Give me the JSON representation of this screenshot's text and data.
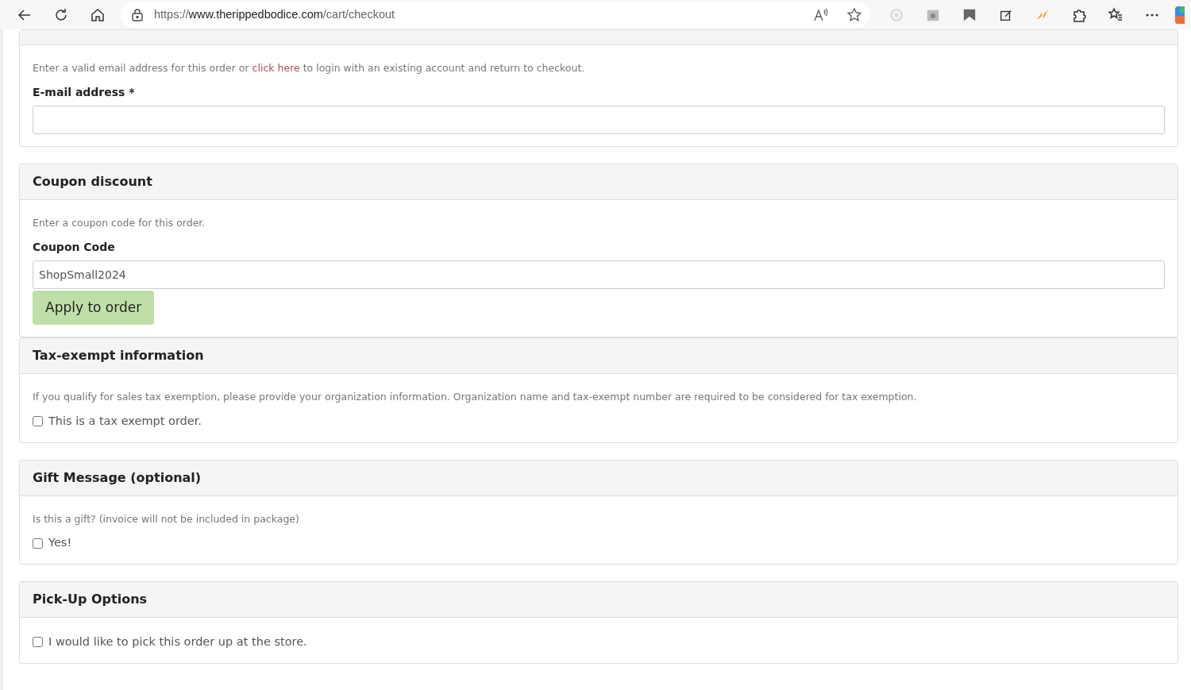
{
  "browser": {
    "url": {
      "scheme": "https://",
      "domain": "www.therippedbodice.com",
      "path": "/cart/checkout"
    }
  },
  "sections": [
    {
      "items": [
        {
          "kind": "text",
          "parts": [
            {
              "text": "Enter a valid email address for this order or ",
              "link": false
            },
            {
              "text": "click here",
              "link": true
            },
            {
              "text": " to login with an existing account and return to checkout.",
              "link": false
            }
          ]
        },
        {
          "kind": "label",
          "text": "E-mail address *"
        },
        {
          "kind": "input",
          "value": ""
        }
      ]
    },
    {
      "title": "Coupon discount",
      "items": [
        {
          "kind": "text",
          "parts": [
            {
              "text": "Enter a coupon code for this order.",
              "link": false
            }
          ]
        },
        {
          "kind": "label",
          "text": "Coupon Code"
        },
        {
          "kind": "input",
          "value": "ShopSmall2024"
        },
        {
          "kind": "button",
          "text": "Apply to order"
        }
      ]
    },
    {
      "title": "Tax-exempt information",
      "items": [
        {
          "kind": "text",
          "parts": [
            {
              "text": "If you qualify for sales tax exemption, please provide your organization information. Organization name and tax-exempt number are required to be considered for tax exemption.",
              "link": false
            }
          ]
        },
        {
          "kind": "checkbox",
          "text": "This is a tax exempt order.",
          "checked": false
        }
      ]
    },
    {
      "title": "Gift Message (optional)",
      "items": [
        {
          "kind": "text",
          "parts": [
            {
              "text": "Is this a gift? (invoice will not be included in package)",
              "link": false
            }
          ]
        },
        {
          "kind": "checkbox",
          "text": "Yes!",
          "checked": false
        }
      ]
    },
    {
      "title": "Pick-Up Options",
      "items": [
        {
          "kind": "checkbox",
          "text": "I would like to pick this order up at the store.",
          "checked": false
        }
      ]
    }
  ]
}
